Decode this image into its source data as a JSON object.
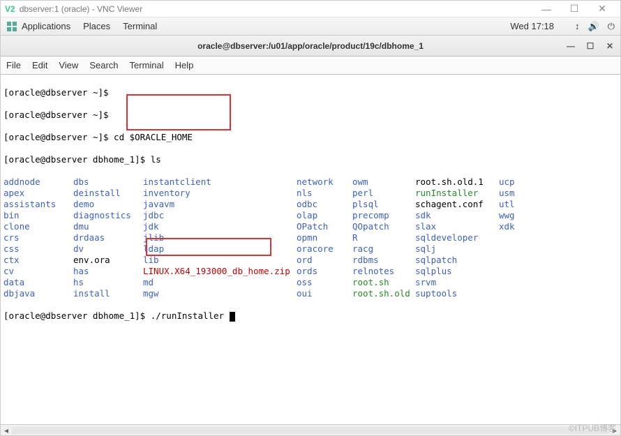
{
  "vnc": {
    "title": "dbserver:1 (oracle) - VNC Viewer",
    "logo": "V2",
    "min": "—",
    "max": "☐",
    "close": "✕"
  },
  "panel": {
    "applications": "Applications",
    "places": "Places",
    "terminal": "Terminal",
    "clock": "Wed 17:18"
  },
  "window": {
    "title": "oracle@dbserver:/u01/app/oracle/product/19c/dbhome_1",
    "min": "—",
    "max": "☐",
    "close": "✕"
  },
  "menubar": {
    "file": "File",
    "edit": "Edit",
    "view": "View",
    "search": "Search",
    "terminal": "Terminal",
    "help": "Help"
  },
  "prompts": {
    "p1": "[oracle@dbserver ~]$",
    "p2": "[oracle@dbserver ~]$",
    "p3": "[oracle@dbserver ~]$ ",
    "p3cmd": "cd $ORACLE_HOME",
    "p4": "[oracle@dbserver dbhome_1]$ ",
    "p4cmd": "ls",
    "p5": "[oracle@dbserver dbhome_1]$ ",
    "p5cmd": "./runInstaller "
  },
  "ls": [
    [
      [
        "addnode",
        "d"
      ],
      [
        "dbs",
        "d"
      ],
      [
        "instantclient",
        "d"
      ],
      [
        "network",
        "d"
      ],
      [
        "owm",
        "d"
      ],
      [
        "root.sh.old.1",
        "f"
      ],
      [
        "ucp",
        "d"
      ]
    ],
    [
      [
        "apex",
        "d"
      ],
      [
        "deinstall",
        "d"
      ],
      [
        "inventory",
        "d"
      ],
      [
        "nls",
        "d"
      ],
      [
        "perl",
        "d"
      ],
      [
        "runInstaller",
        "x"
      ],
      [
        "usm",
        "d"
      ]
    ],
    [
      [
        "assistants",
        "d"
      ],
      [
        "demo",
        "d"
      ],
      [
        "javavm",
        "d"
      ],
      [
        "odbc",
        "d"
      ],
      [
        "plsql",
        "d"
      ],
      [
        "schagent.conf",
        "f"
      ],
      [
        "utl",
        "d"
      ]
    ],
    [
      [
        "bin",
        "d"
      ],
      [
        "diagnostics",
        "d"
      ],
      [
        "jdbc",
        "d"
      ],
      [
        "olap",
        "d"
      ],
      [
        "precomp",
        "d"
      ],
      [
        "sdk",
        "d"
      ],
      [
        "wwg",
        "d"
      ]
    ],
    [
      [
        "clone",
        "d"
      ],
      [
        "dmu",
        "d"
      ],
      [
        "jdk",
        "d"
      ],
      [
        "OPatch",
        "d"
      ],
      [
        "QOpatch",
        "d"
      ],
      [
        "slax",
        "d"
      ],
      [
        "xdk",
        "d"
      ]
    ],
    [
      [
        "crs",
        "d"
      ],
      [
        "drdaas",
        "d"
      ],
      [
        "jlib",
        "d"
      ],
      [
        "opmn",
        "d"
      ],
      [
        "R",
        "d"
      ],
      [
        "sqldeveloper",
        "d"
      ],
      [
        "",
        ""
      ]
    ],
    [
      [
        "css",
        "d"
      ],
      [
        "dv",
        "d"
      ],
      [
        "ldap",
        "d"
      ],
      [
        "oracore",
        "d"
      ],
      [
        "racg",
        "d"
      ],
      [
        "sqlj",
        "d"
      ],
      [
        "",
        ""
      ]
    ],
    [
      [
        "ctx",
        "d"
      ],
      [
        "env.ora",
        "f"
      ],
      [
        "lib",
        "d"
      ],
      [
        "ord",
        "d"
      ],
      [
        "rdbms",
        "d"
      ],
      [
        "sqlpatch",
        "d"
      ],
      [
        "",
        ""
      ]
    ],
    [
      [
        "cv",
        "d"
      ],
      [
        "has",
        "d"
      ],
      [
        "LINUX.X64_193000_db_home.zip",
        "z"
      ],
      [
        "ords",
        "d"
      ],
      [
        "relnotes",
        "d"
      ],
      [
        "sqlplus",
        "d"
      ],
      [
        "",
        ""
      ]
    ],
    [
      [
        "data",
        "d"
      ],
      [
        "hs",
        "d"
      ],
      [
        "md",
        "d"
      ],
      [
        "oss",
        "d"
      ],
      [
        "root.sh",
        "x"
      ],
      [
        "srvm",
        "d"
      ],
      [
        "",
        ""
      ]
    ],
    [
      [
        "dbjava",
        "d"
      ],
      [
        "install",
        "d"
      ],
      [
        "mgw",
        "d"
      ],
      [
        "oui",
        "d"
      ],
      [
        "root.sh.old",
        "x"
      ],
      [
        "suptools",
        "d"
      ],
      [
        "",
        ""
      ]
    ]
  ],
  "watermark": "©ITPUB博客"
}
